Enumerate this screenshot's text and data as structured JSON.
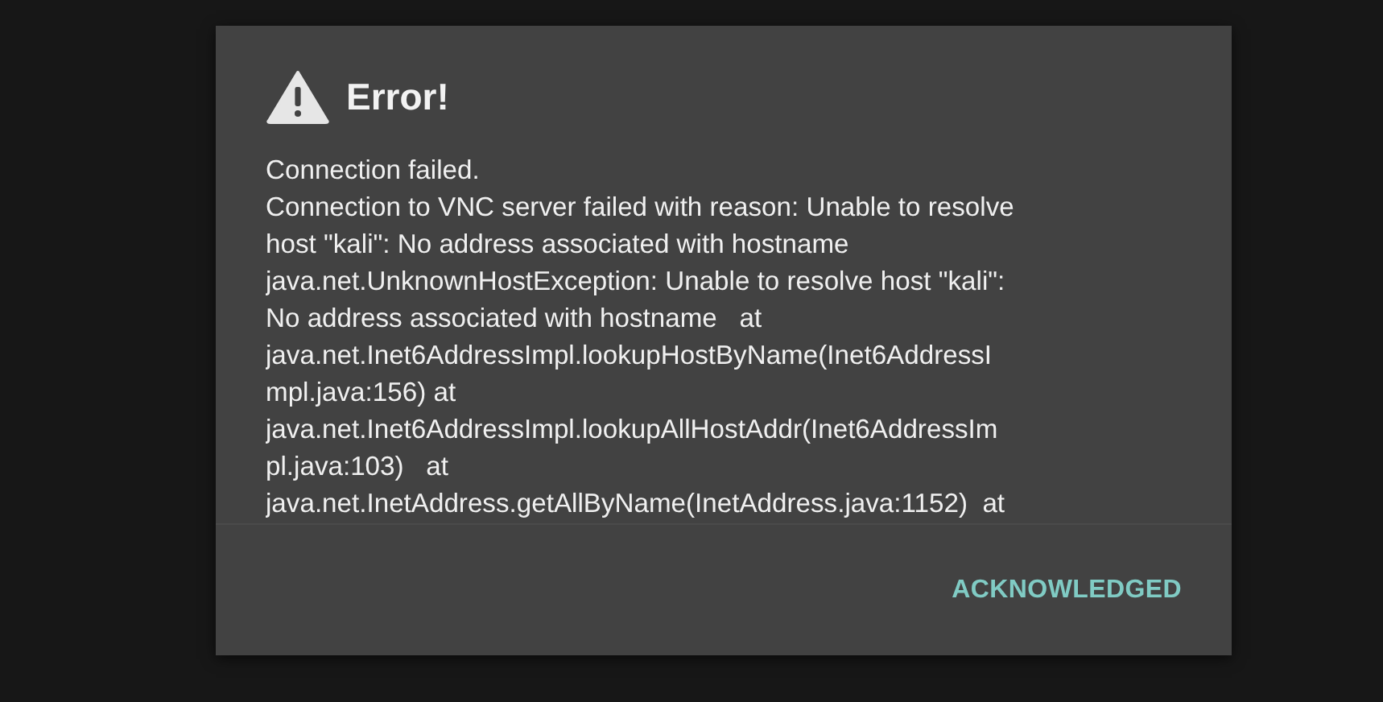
{
  "dialog": {
    "title": "Error!",
    "message_lines": [
      "Connection failed.",
      "Connection to VNC server failed with reason: Unable to resolve",
      "host \"kali\": No address associated with hostname",
      "java.net.UnknownHostException: Unable to resolve host \"kali\":",
      "No address associated with hostname   at",
      "java.net.Inet6AddressImpl.lookupHostByName(Inet6AddressI",
      "mpl.java:156) at",
      "java.net.Inet6AddressImpl.lookupAllHostAddr(Inet6AddressIm",
      "pl.java:103)   at",
      "java.net.InetAddress.getAllByName(InetAddress.java:1152)  at"
    ],
    "buttons": [
      "ACKNOWLEDGED"
    ]
  }
}
